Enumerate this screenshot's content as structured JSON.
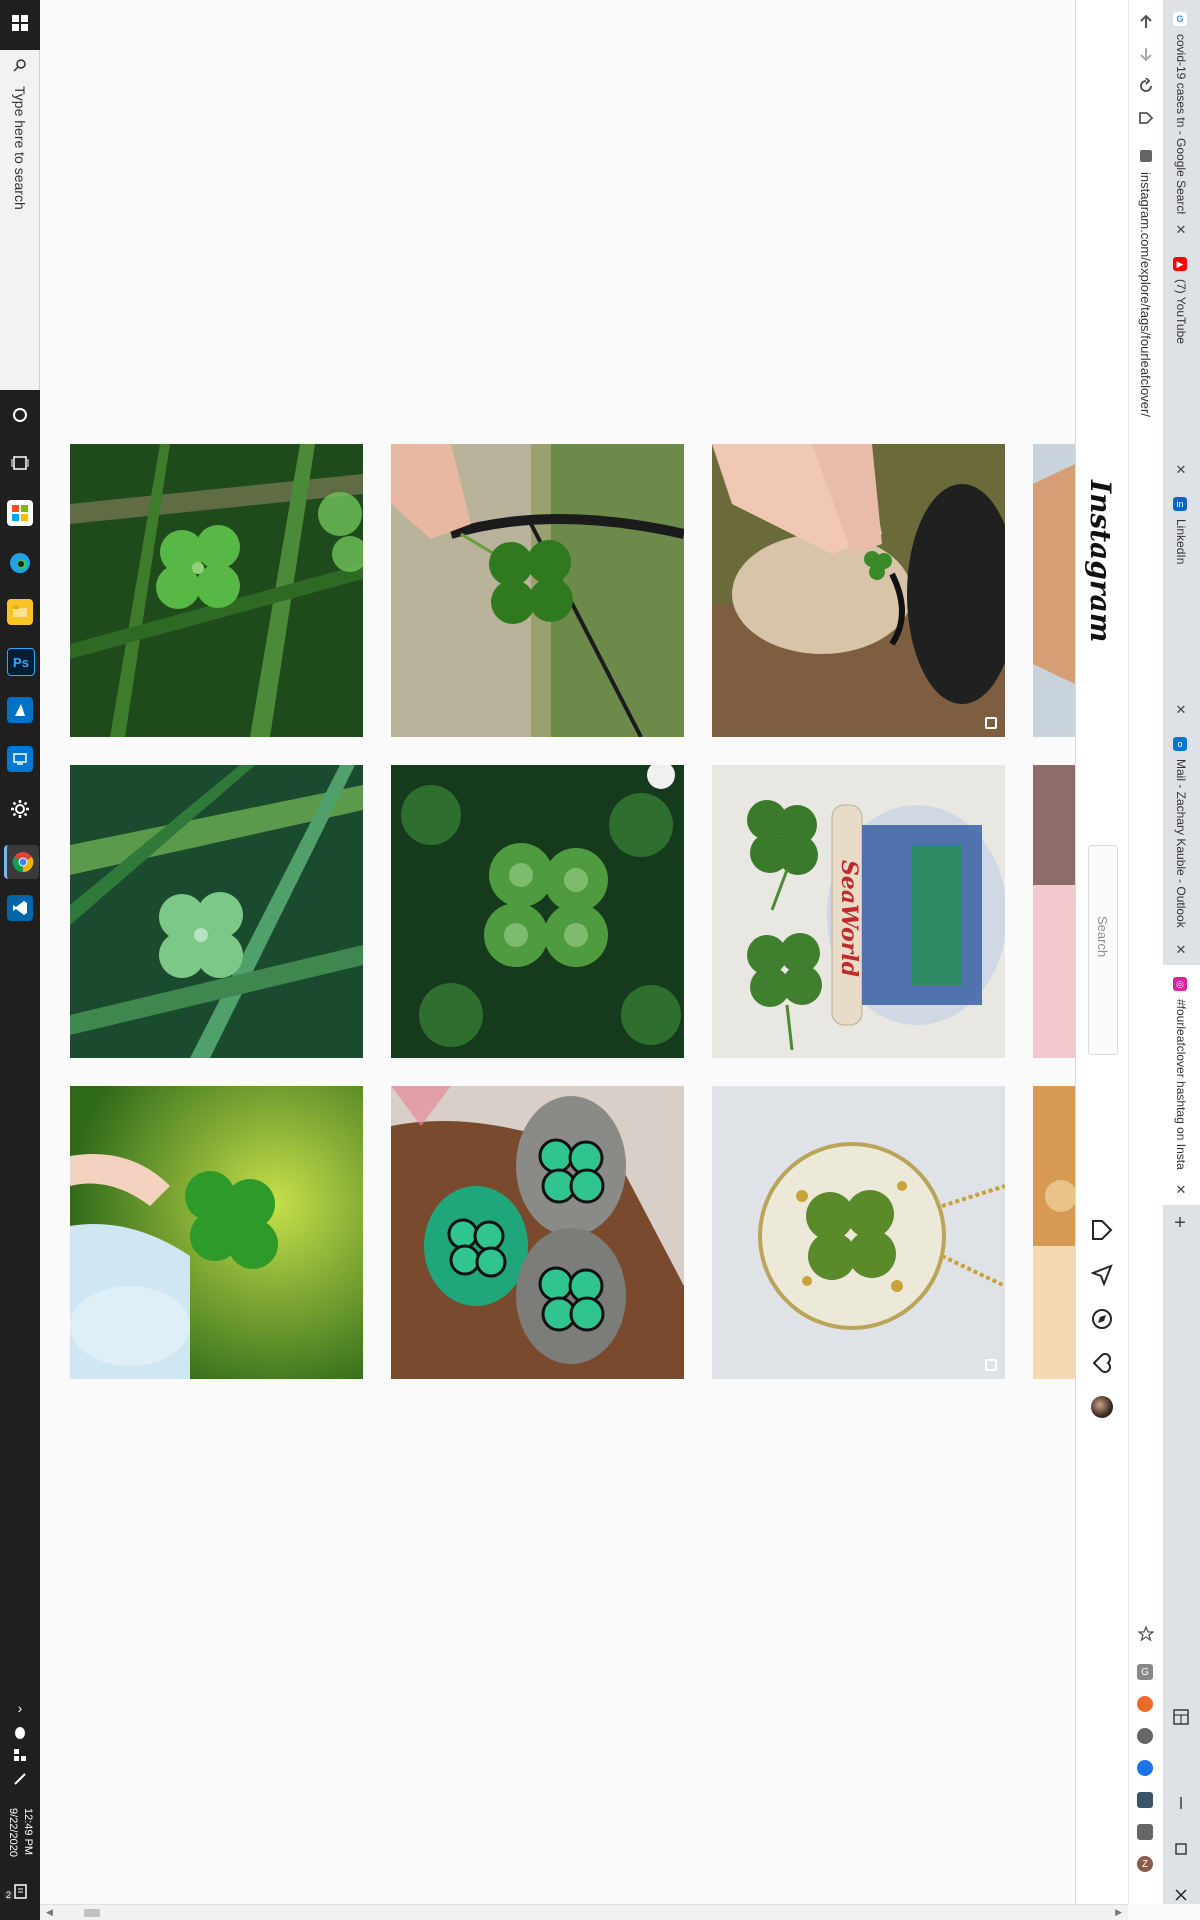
{
  "taskbar": {
    "search_placeholder": "Type here to search",
    "time": "12:49 PM",
    "date": "9/22/2020",
    "notification_count": "2",
    "pinned_apps": [
      "cortana-icon",
      "task-view-icon",
      "store-icon",
      "edge-icon",
      "file-explorer-icon",
      "photoshop-icon",
      "azure-icon",
      "remote-desktop-icon",
      "settings-icon",
      "chrome-icon",
      "vscode-icon"
    ],
    "photoshop_label": "Ps"
  },
  "browser": {
    "address": "instagram.com/explore/tags/fourleafclover/",
    "tabs": [
      {
        "title": "covid-19 cases tn - Google Search",
        "favicon": "google-icon",
        "color": "#ffffff"
      },
      {
        "title": "(7) YouTube",
        "favicon": "youtube-icon",
        "color": "#ff0000"
      },
      {
        "title": "LinkedIn",
        "favicon": "linkedin-icon",
        "color": "#0a66c2"
      },
      {
        "title": "Mail - Zachary Kauble - Outlook",
        "favicon": "outlook-icon",
        "color": "#0078d4"
      },
      {
        "title": "#fourleafclover hashtag on Insta",
        "favicon": "instagram-icon",
        "color": "#d6249f"
      }
    ],
    "new_tab_label": "+",
    "extension_letters": [
      "G",
      "Z"
    ]
  },
  "instagram": {
    "logo": "Instagram",
    "search_placeholder": "Search",
    "nav": [
      "home-icon",
      "direct-icon",
      "explore-icon",
      "activity-icon",
      "profile-avatar"
    ]
  },
  "grid": {
    "tiles": [
      {
        "row": 1,
        "col": 1,
        "subject": "clover in grass"
      },
      {
        "row": 1,
        "col": 2,
        "subject": "hand holding clover over trees"
      },
      {
        "row": 1,
        "col": 3,
        "subject": "hand with clover and pug",
        "multi": true
      },
      {
        "row": 1,
        "col": 4,
        "subject": "partial image"
      },
      {
        "row": 2,
        "col": 1,
        "subject": "clover among blades"
      },
      {
        "row": 2,
        "col": 2,
        "subject": "clover patch"
      },
      {
        "row": 2,
        "col": 3,
        "subject": "snow globe with clovers",
        "text": "SeaWorld"
      },
      {
        "row": 2,
        "col": 4,
        "subject": "partial image"
      },
      {
        "row": 3,
        "col": 1,
        "subject": "clover on jar"
      },
      {
        "row": 3,
        "col": 2,
        "subject": "painted clover rocks"
      },
      {
        "row": 3,
        "col": 3,
        "subject": "resin clover pendant",
        "multi": true
      },
      {
        "row": 3,
        "col": 4,
        "subject": "partial image"
      }
    ]
  },
  "colors": {
    "page_bg": "#fafafa",
    "taskbar": "#1f1f1f",
    "tabstrip": "#dee1e6"
  }
}
